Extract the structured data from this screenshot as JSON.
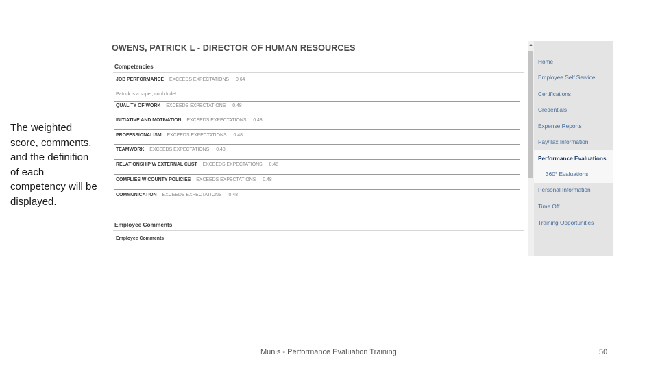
{
  "caption": "The weighted score, comments, and the definition of each competency will be displayed.",
  "screen": {
    "title": "OWENS, PATRICK L - DIRECTOR OF HUMAN RESOURCES",
    "competencies_header": "Competencies",
    "competencies": [
      {
        "name": "JOB PERFORMANCE",
        "rating": "EXCEEDS EXPECTATIONS",
        "score": "0.64"
      },
      {
        "name": "QUALITY OF WORK",
        "rating": "EXCEEDS EXPECTATIONS",
        "score": "0.48"
      },
      {
        "name": "INITIATIVE AND MOTIVATION",
        "rating": "EXCEEDS EXPECTATIONS",
        "score": "0.48"
      },
      {
        "name": "PROFESSIONALISM",
        "rating": "EXCEEDS EXPECTATIONS",
        "score": "0.48"
      },
      {
        "name": "TEAMWORK",
        "rating": "EXCEEDS EXPECTATIONS",
        "score": "0.48"
      },
      {
        "name": "RELATIONSHIP W EXTERNAL CUST",
        "rating": "EXCEEDS EXPECTATIONS",
        "score": "0.48"
      },
      {
        "name": "COMPLIES W COUNTY POLICIES",
        "rating": "EXCEEDS EXPECTATIONS",
        "score": "0.48"
      },
      {
        "name": "COMMUNICATION",
        "rating": "EXCEEDS EXPECTATIONS",
        "score": "0.48"
      }
    ],
    "comment": "Patrick is a super, cool dude!",
    "employee_comments_header": "Employee Comments",
    "employee_comments_sub": "Employee Comments"
  },
  "nav": {
    "items": [
      "Home",
      "Employee Self Service",
      "Certifications",
      "Credentials",
      "Expense Reports",
      "Pay/Tax Information",
      "Performance Evaluations",
      "Personal Information",
      "Time Off",
      "Training Opportunities"
    ],
    "active": "Performance Evaluations",
    "sub_item": "360° Evaluations"
  },
  "footer": {
    "text": "Munis - Performance Evaluation Training",
    "page": "50"
  },
  "colors": {
    "nav_link": "#446c9c",
    "nav_bg": "#e4e4e4"
  }
}
